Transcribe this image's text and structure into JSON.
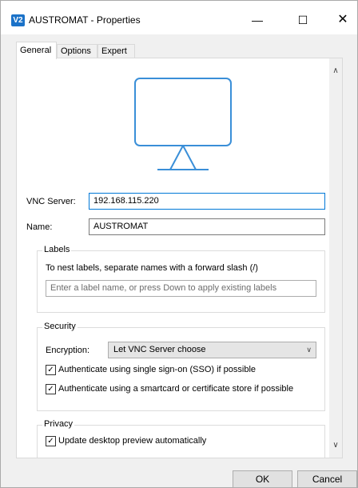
{
  "window": {
    "title": "AUSTROMAT - Properties",
    "app_icon_text": "V2",
    "minimize_glyph": "—",
    "maximize_glyph": "☐",
    "close_glyph": "✕"
  },
  "tabs": [
    {
      "label": "General",
      "active": true
    },
    {
      "label": "Options",
      "active": false
    },
    {
      "label": "Expert",
      "active": false
    }
  ],
  "general": {
    "icon": "monitor-icon",
    "accent": "#3a8fd8",
    "vnc_server_label": "VNC Server:",
    "vnc_server_value": "192.168.115.220",
    "name_label": "Name:",
    "name_value": "AUSTROMAT",
    "labels_group": {
      "title": "Labels",
      "hint": "To nest labels, separate names with a forward slash (/)",
      "input_placeholder": "Enter a label name, or press Down to apply existing labels"
    },
    "security_group": {
      "title": "Security",
      "encryption_label": "Encryption:",
      "encryption_value": "Let VNC Server choose",
      "sso_label": "Authenticate using single sign-on (SSO) if possible",
      "sso_checked": true,
      "smartcard_label": "Authenticate using a smartcard or certificate store if possible",
      "smartcard_checked": true
    },
    "privacy_group": {
      "title": "Privacy",
      "preview_label": "Update desktop preview automatically",
      "preview_checked": true
    }
  },
  "buttons": {
    "ok_label": "OK",
    "cancel_label": "Cancel"
  }
}
